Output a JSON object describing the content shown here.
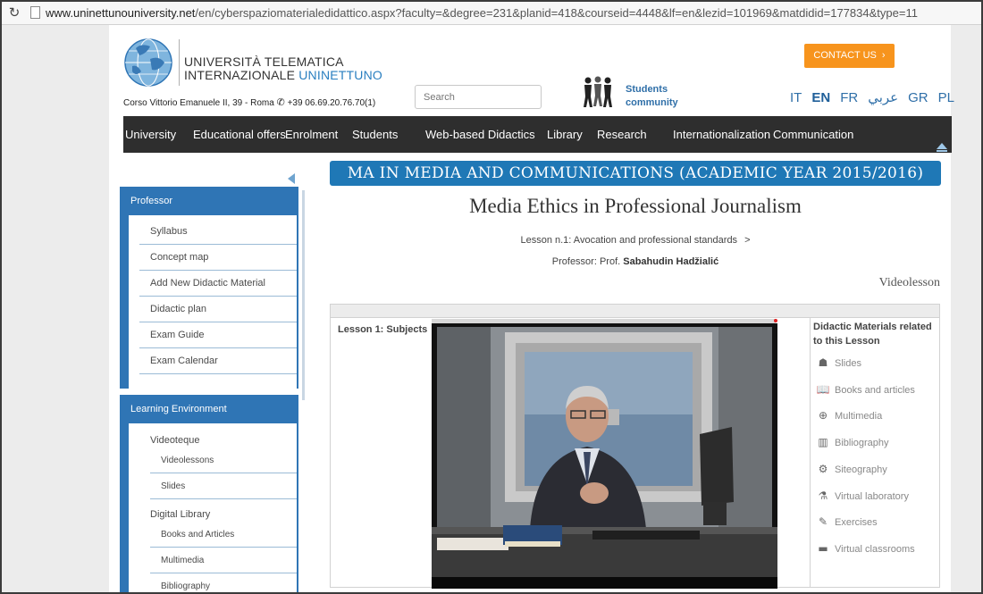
{
  "browser": {
    "url_domain": "www.uninettunouniversity.net",
    "url_path": "/en/cyberspaziomaterialedidattico.aspx?faculty=&degree=231&planid=418&courseid=4448&lf=en&lezid=101969&matdidid=177834&type=11"
  },
  "header": {
    "name_line1": "UNIVERSITÀ TELEMATICA",
    "name_line2_prefix": "INTERNAZIONALE ",
    "name_line2_accent": "UNINETTUNO",
    "address": "Corso Vittorio Emanuele II, 39 - Roma",
    "phone": "+39 06.69.20.76.70(1)",
    "search_placeholder": "Search",
    "students_line1": "Students",
    "students_line2": "community",
    "contact_label": "CONTACT US",
    "languages": [
      "IT",
      "EN",
      "FR",
      "عربي",
      "GR",
      "PL"
    ],
    "active_language": "EN"
  },
  "nav": {
    "items": [
      "University",
      "Educational offers",
      "Enrolment",
      "Students",
      "Web-based Didactics",
      "Library",
      "Research",
      "Internationalization",
      "Communication"
    ]
  },
  "sidebar": {
    "professor_heading": "Professor",
    "professor_items": [
      "Syllabus",
      "Concept map",
      "Add New Didactic Material",
      "Didactic plan",
      "Exam Guide",
      "Exam Calendar"
    ],
    "learning_heading": "Learning Environment",
    "videoteque_label": "Videoteque",
    "videoteque_items": [
      "Videolessons",
      "Slides"
    ],
    "digital_library_label": "Digital Library",
    "digital_library_items": [
      "Books and Articles",
      "Multimedia",
      "Bibliography"
    ]
  },
  "main": {
    "banner": "MA IN MEDIA AND COMMUNICATIONS (ACADEMIC YEAR 2015/2016)",
    "course_title": "Media Ethics in Professional Journalism",
    "lesson_line": "Lesson n.1: Avocation and professional standards",
    "lesson_arrow": ">",
    "professor_prefix": "Professor: Prof.",
    "professor_name": "Sabahudin Hadžialić",
    "type_label": "Videolesson",
    "lesson_subjects": "Lesson 1: Subjects",
    "materials_title": "Didactic Materials related to this Lesson",
    "materials": [
      "Slides",
      "Books and articles",
      "Multimedia",
      "Bibliography",
      "Siteography",
      "Virtual laboratory",
      "Exercises",
      "Virtual classrooms"
    ]
  },
  "colors": {
    "nav_bg": "#2e2e2e",
    "sidebar_blue": "#2f75b5",
    "banner_blue": "#1f78b6",
    "contact_orange": "#f7941d",
    "link_blue": "#2f6fa8"
  }
}
